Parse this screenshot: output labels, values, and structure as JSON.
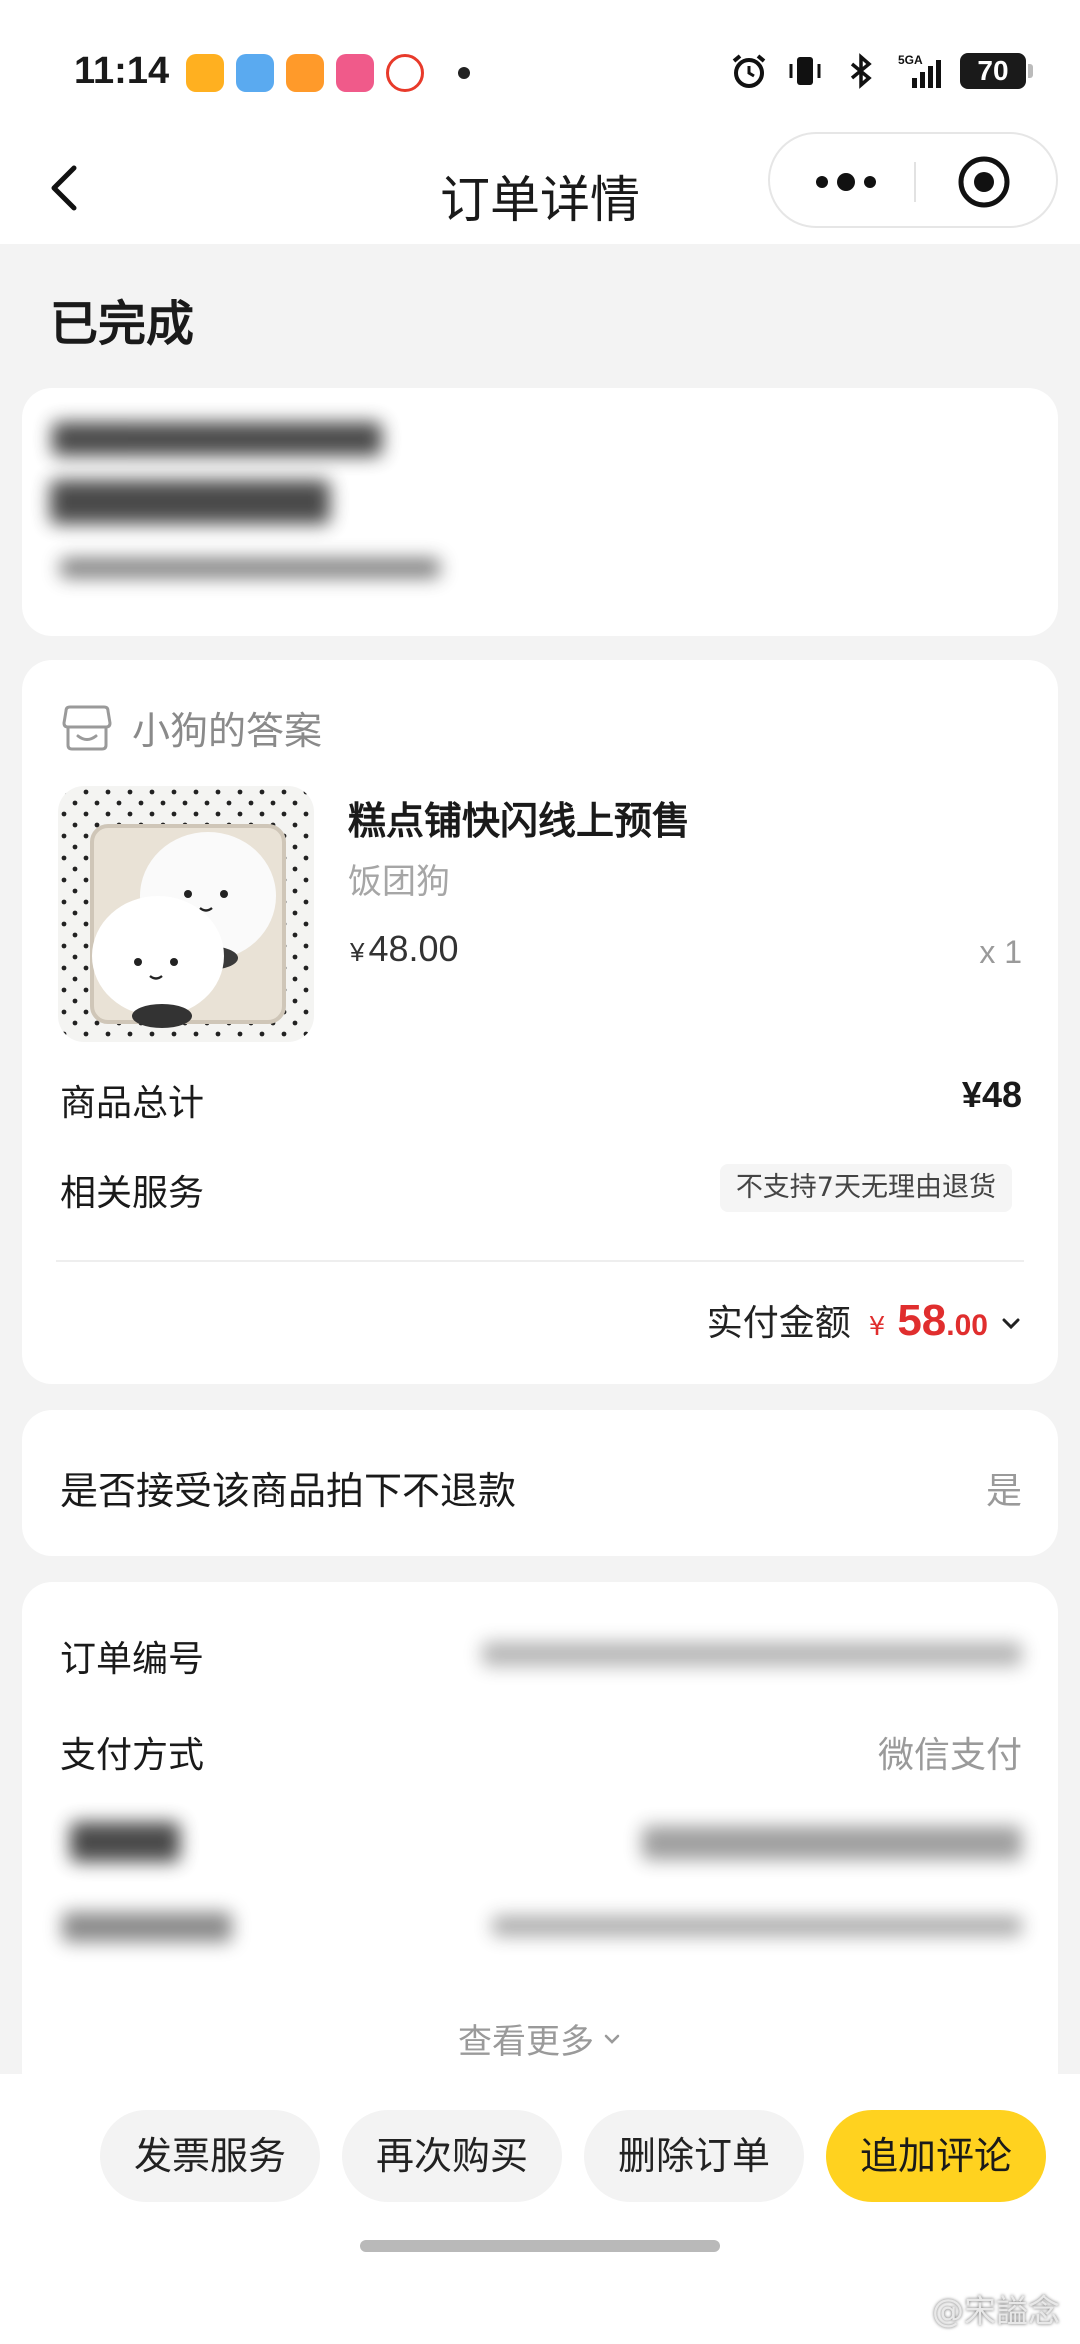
{
  "status_bar": {
    "time": "11:14",
    "network": "5GA",
    "battery": "70"
  },
  "nav": {
    "title": "订单详情"
  },
  "order_status": "已完成",
  "shop": {
    "name": "小狗的答案"
  },
  "goods": {
    "title": "糕点铺快闪线上预售",
    "spec": "饭团狗",
    "price": "48.00",
    "currency": "¥",
    "quantity": "x 1"
  },
  "summary": {
    "total_label": "商品总计",
    "total_value": "¥48",
    "service_label": "相关服务",
    "service_tag": "不支持7天无理由退货",
    "paid_label": "实付金额",
    "paid_currency": "¥",
    "paid_int": "58",
    "paid_dec": ".00"
  },
  "refund": {
    "question": "是否接受该商品拍下不退款",
    "answer": "是"
  },
  "info": {
    "order_no_label": "订单编号",
    "pay_method_label": "支付方式",
    "pay_method_value": "微信支付",
    "more": "查看更多"
  },
  "actions": {
    "invoice": "发票服务",
    "rebuy": "再次购买",
    "delete": "删除订单",
    "review": "追加评论"
  },
  "watermark": "@宋謚念",
  "colors": {
    "accent_yellow": "#ffd21f",
    "price_red": "#e02e2e"
  }
}
